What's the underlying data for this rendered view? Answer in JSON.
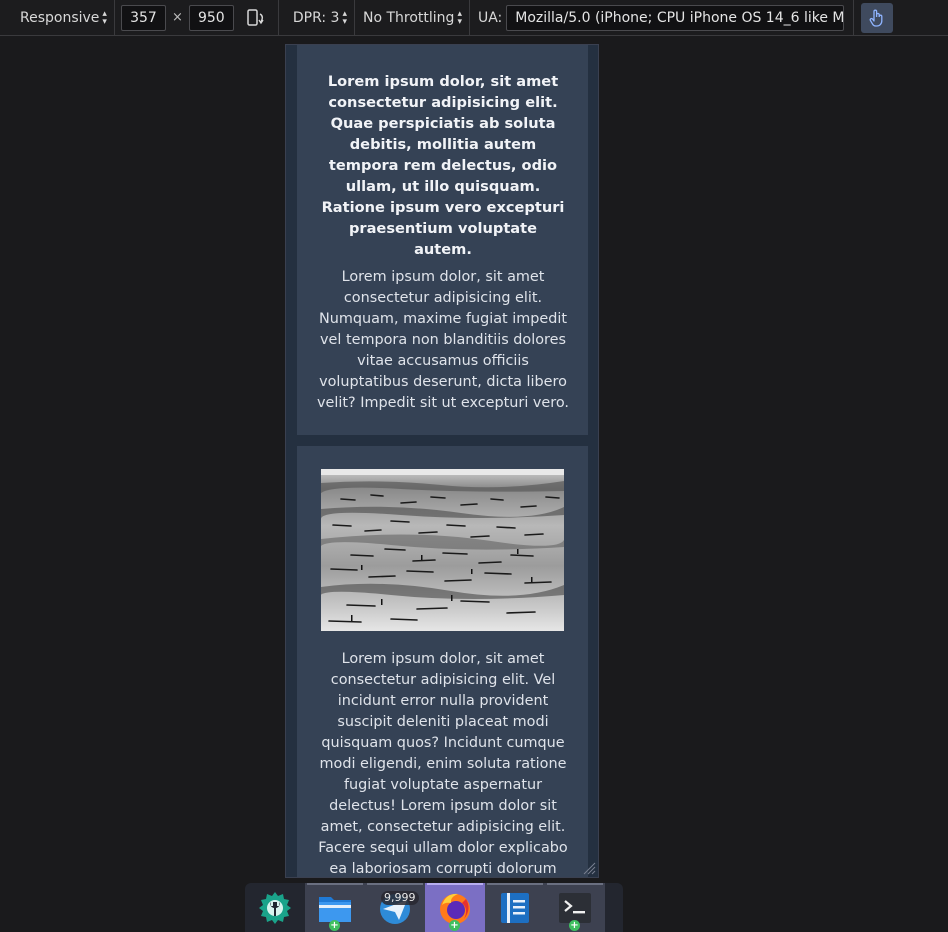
{
  "toolbar": {
    "device_mode": "Responsive",
    "width": "357",
    "times": "×",
    "height": "950",
    "dpr": "DPR: 3",
    "throttling": "No Throttling",
    "ua_label": "UA:",
    "ua_value": "Mozilla/5.0 (iPhone; CPU iPhone OS 14_6 like M",
    "rotate_icon": "rotate-device-icon",
    "touch_icon": "touch-simulation-icon"
  },
  "page": {
    "card1": {
      "bold_paragraph": "Lorem ipsum dolor, sit amet consectetur adipisicing elit. Quae perspiciatis ab soluta debitis, mollitia autem tempora rem delectus, odio ullam, ut illo quisquam. Ratione ipsum vero excepturi praesentium voluptate autem.",
      "paragraph": "Lorem ipsum dolor, sit amet consectetur adipisicing elit. Numquam, maxime fugiat impedit vel tempora non blanditiis dolores vitae accusamus officiis voluptatibus deserunt, dicta libero velit? Impedit sit ut excepturi vero."
    },
    "card2": {
      "image": "black-and-white photo of fishing boats on a shore",
      "paragraph": "Lorem ipsum dolor, sit amet consectetur adipisicing elit. Vel incidunt error nulla provident suscipit deleniti placeat modi quisquam quos? Incidunt cumque modi eligendi, enim soluta ratione fugiat voluptate aspernatur delectus! Lorem ipsum dolor sit amet, consectetur adipisicing elit. Facere sequi ullam dolor explicabo ea laboriosam corrupti dolorum fuga, eveniet?"
    }
  },
  "taskbar": {
    "items": [
      {
        "icon": "settings-wrench-icon"
      },
      {
        "icon": "file-manager-icon"
      },
      {
        "icon": "mail-icon",
        "badge": "9,999"
      },
      {
        "icon": "firefox-icon"
      },
      {
        "icon": "text-editor-icon"
      },
      {
        "icon": "terminal-icon"
      }
    ]
  },
  "colors": {
    "toolbar_bg": "#1c1c1e",
    "viewport_bg": "#243040",
    "card_bg": "#354255",
    "focused_task": "#7b6fc4"
  }
}
